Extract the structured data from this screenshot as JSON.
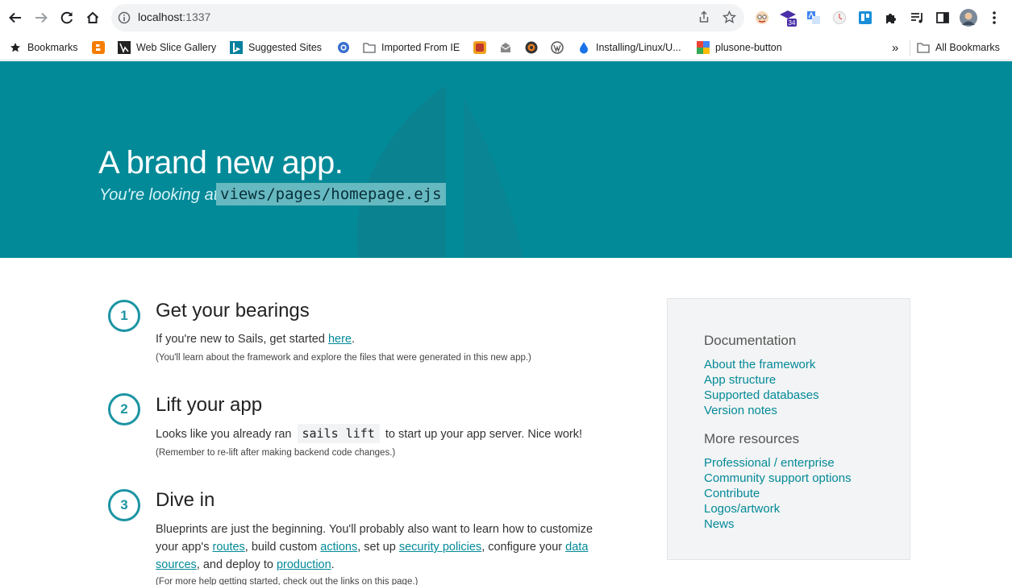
{
  "browser": {
    "url_host": "localhost",
    "url_port": ":1337",
    "ext_badge": "34",
    "bookmarks": [
      {
        "label": "Bookmarks"
      },
      {
        "label": ""
      },
      {
        "label": "Web Slice Gallery"
      },
      {
        "label": "Suggested Sites"
      },
      {
        "label": ""
      },
      {
        "label": "Imported From IE"
      },
      {
        "label": ""
      },
      {
        "label": ""
      },
      {
        "label": ""
      },
      {
        "label": ""
      },
      {
        "label": "Installing/Linux/U..."
      },
      {
        "label": "plusone-button"
      }
    ],
    "overflow": "»",
    "all_bookmarks": "All Bookmarks"
  },
  "hero": {
    "title": "A brand new app.",
    "subtitle": "You're looking at:",
    "file": "views/pages/homepage.ejs"
  },
  "steps": [
    {
      "number": "1",
      "title": "Get your bearings",
      "text_before": "If you're new to Sails, get started ",
      "link": "here",
      "text_after": ".",
      "note": "(You'll learn about the framework and explore the files that were generated in this new app.)"
    },
    {
      "number": "2",
      "title": "Lift your app",
      "text_before": "Looks like you already ran ",
      "code": "sails lift",
      "text_after": " to start up your app server. Nice work!",
      "note": "(Remember to re-lift after making backend code changes.)"
    },
    {
      "number": "3",
      "title": "Dive in",
      "t1": "Blueprints are just the beginning. You'll probably also want to learn how to customize your app's ",
      "l1": "routes",
      "t2": ", build custom ",
      "l2": "actions",
      "t3": ", set up ",
      "l3": "security policies",
      "t4": ", configure your ",
      "l4": "data sources",
      "t5": ", and deploy to ",
      "l5": "production",
      "t6": ".",
      "note": "(For more help getting started, check out the links on this page.)"
    }
  ],
  "sidebar": {
    "documentation_heading": "Documentation",
    "documentation_links": [
      "About the framework",
      "App structure",
      "Supported databases",
      "Version notes"
    ],
    "resources_heading": "More resources",
    "resources_links": [
      "Professional / enterprise",
      "Community support options",
      "Contribute",
      "Logos/artwork",
      "News"
    ]
  },
  "colors": {
    "hero_bg": "#038a98",
    "accent": "#1c94a3",
    "link": "#038a98"
  }
}
